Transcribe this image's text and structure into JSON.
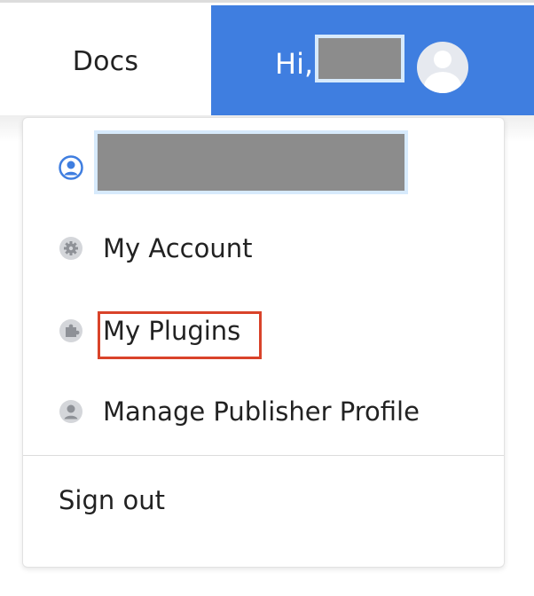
{
  "header": {
    "docs_label": "Docs",
    "greeting": "Hi,"
  },
  "menu": {
    "items": [
      {
        "label": "",
        "icon": "user-circle-icon"
      },
      {
        "label": "My Account",
        "icon": "gear-icon"
      },
      {
        "label": "My Plugins",
        "icon": "puzzle-icon",
        "highlighted": true
      },
      {
        "label": "Manage Publisher Profile",
        "icon": "person-icon"
      }
    ],
    "sign_out_label": "Sign out"
  },
  "colors": {
    "header_active_bg": "#3f7ee0",
    "account_icon": "#3f7ee0",
    "highlight_border": "#d9432a",
    "redaction": "#8c8c8c"
  }
}
